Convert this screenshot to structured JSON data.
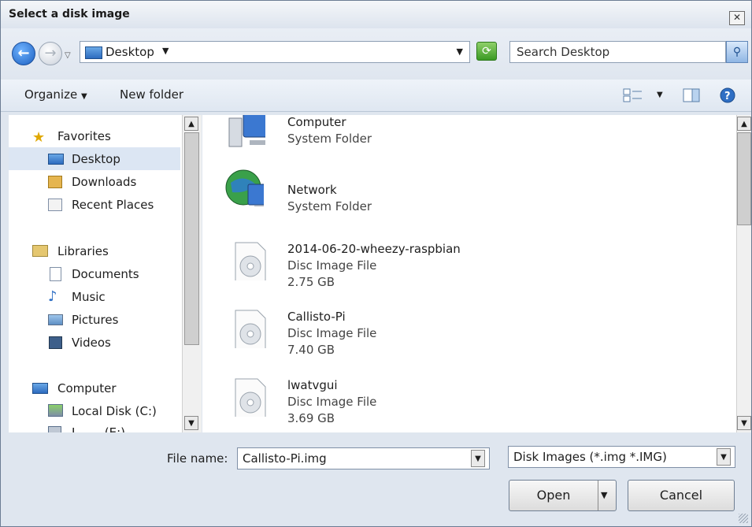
{
  "window": {
    "title": "Select a disk image",
    "close_label": "✕"
  },
  "address": {
    "location": "Desktop",
    "search_placeholder": "Search Desktop"
  },
  "toolbar": {
    "organize_label": "Organize",
    "new_folder_label": "New folder"
  },
  "nav": {
    "favorites": "Favorites",
    "desktop": "Desktop",
    "downloads": "Downloads",
    "recent": "Recent Places",
    "libraries": "Libraries",
    "documents": "Documents",
    "music": "Music",
    "pictures": "Pictures",
    "videos": "Videos",
    "computer": "Computer",
    "localdisk": "Local Disk (C:)",
    "partial": "L . . . (E:)"
  },
  "files": [
    {
      "name": "Computer",
      "type": "System Folder",
      "size": ""
    },
    {
      "name": "Network",
      "type": "System Folder",
      "size": ""
    },
    {
      "name": "2014-06-20-wheezy-raspbian",
      "type": "Disc Image File",
      "size": "2.75 GB"
    },
    {
      "name": "Callisto-Pi",
      "type": "Disc Image File",
      "size": "7.40 GB"
    },
    {
      "name": "lwatvgui",
      "type": "Disc Image File",
      "size": "3.69 GB"
    }
  ],
  "bottom": {
    "filename_label": "File name:",
    "filename_value": "Callisto-Pi.img",
    "filter_value": "Disk Images (*.img *.IMG)",
    "open_label": "Open",
    "cancel_label": "Cancel"
  }
}
